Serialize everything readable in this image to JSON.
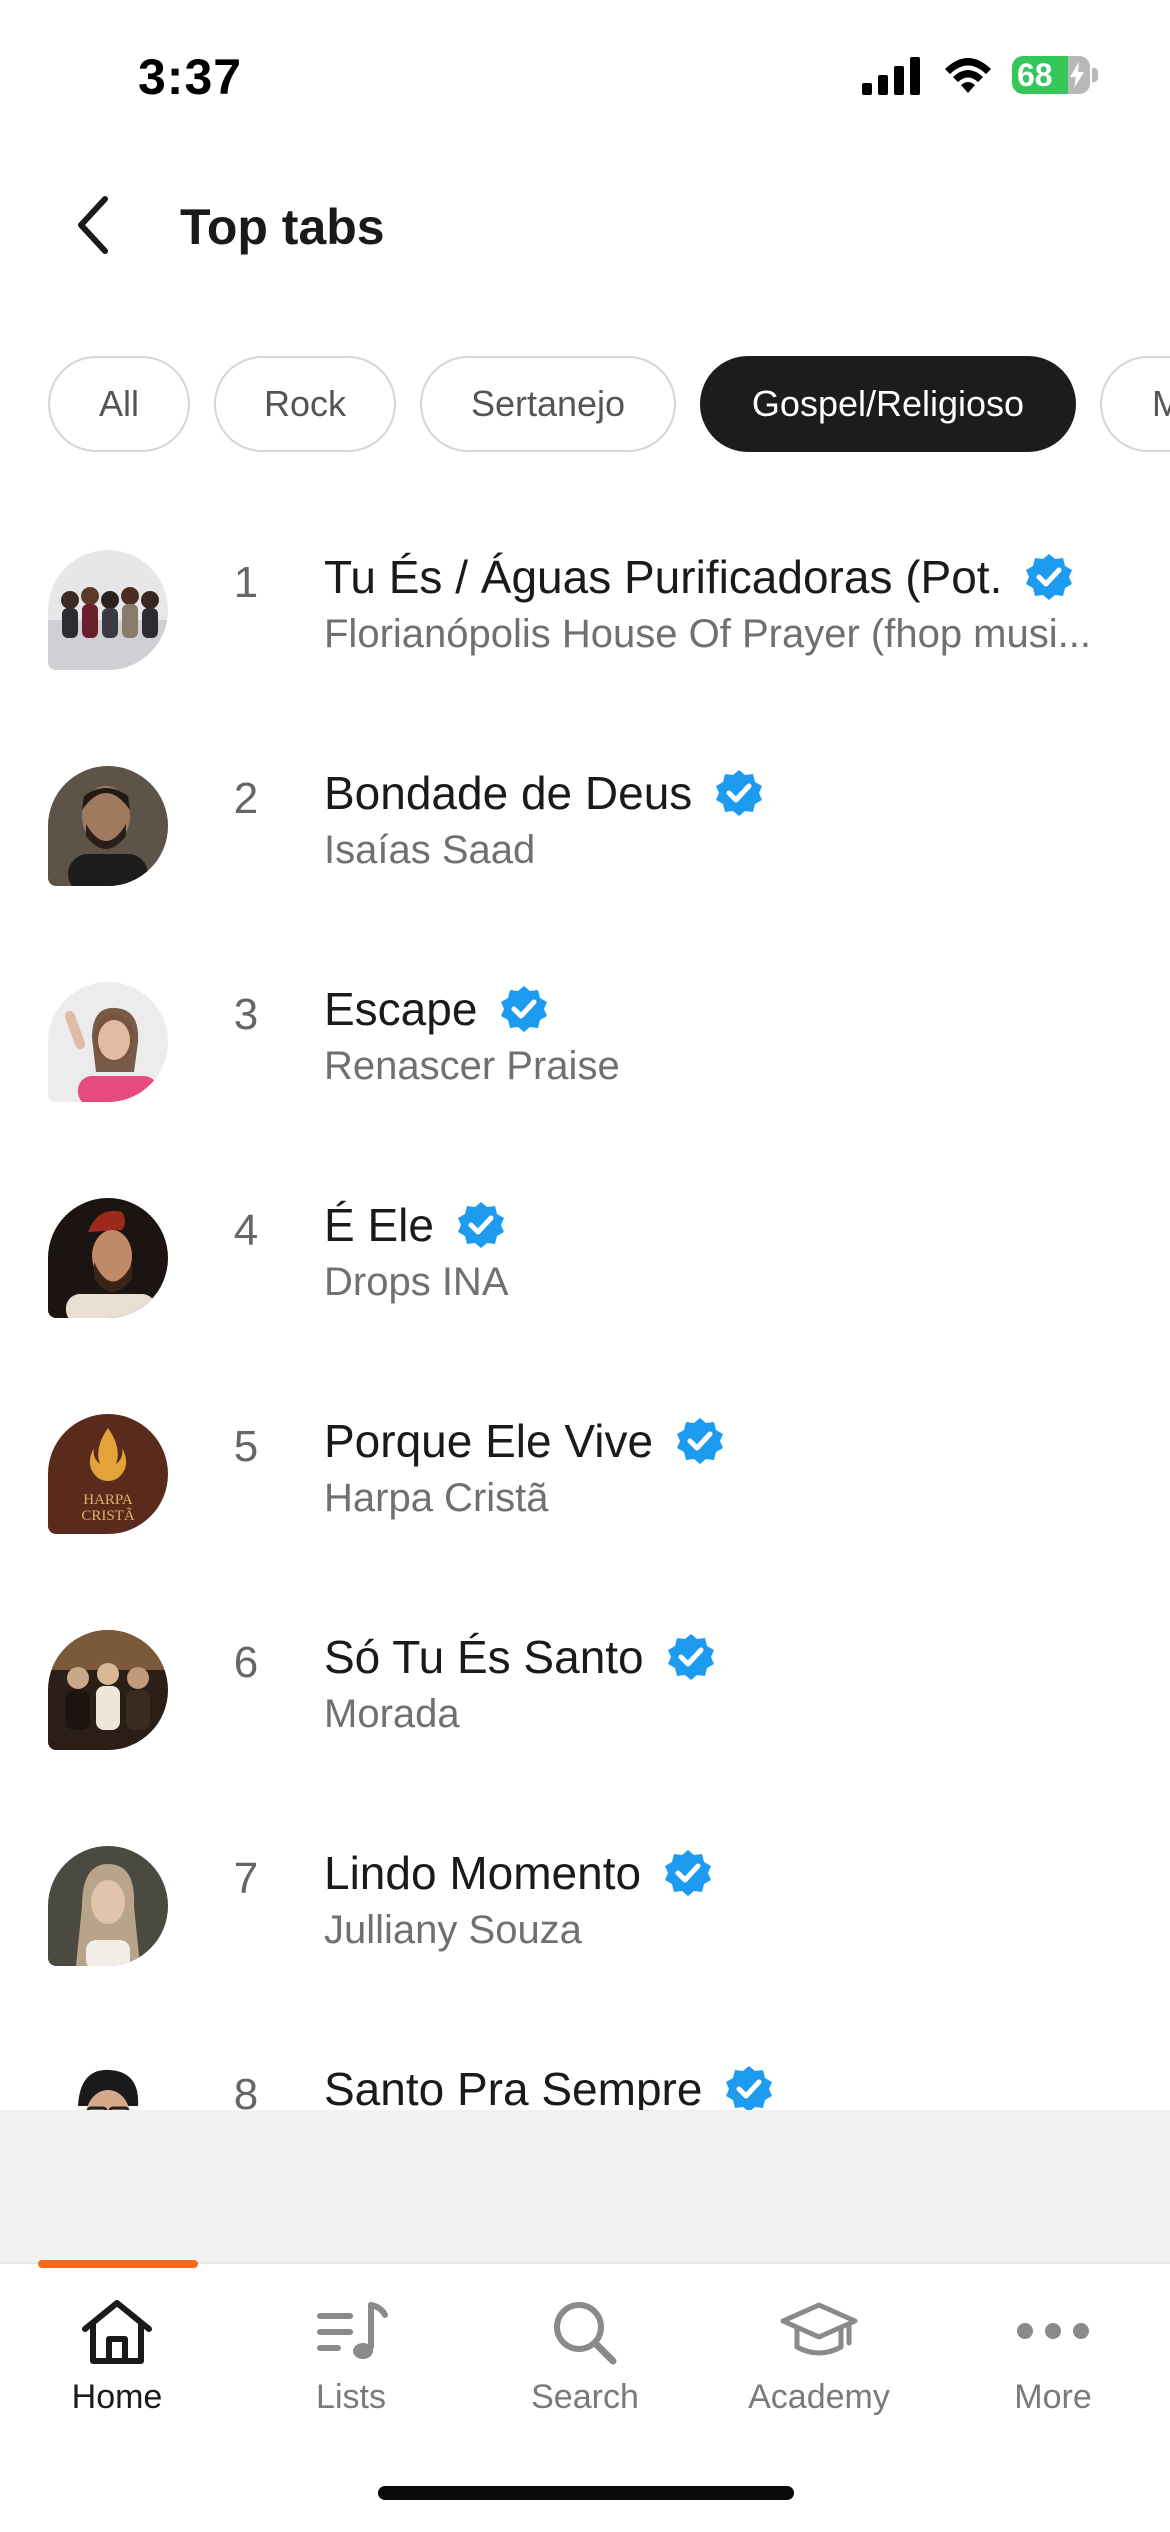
{
  "status_bar": {
    "time": "3:37",
    "battery": "68"
  },
  "header": {
    "title": "Top tabs"
  },
  "chips": [
    {
      "label": "All",
      "active": false
    },
    {
      "label": "Rock",
      "active": false
    },
    {
      "label": "Sertanejo",
      "active": false
    },
    {
      "label": "Gospel/Religioso",
      "active": true
    },
    {
      "label": "M",
      "active": false
    }
  ],
  "list": [
    {
      "rank": "1",
      "title": "Tu És / Águas Purificadoras (Pot.",
      "artist": "Florianópolis House Of Prayer (fhop musi...",
      "verified": true
    },
    {
      "rank": "2",
      "title": "Bondade de Deus",
      "artist": "Isaías Saad",
      "verified": true
    },
    {
      "rank": "3",
      "title": "Escape",
      "artist": "Renascer Praise",
      "verified": true
    },
    {
      "rank": "4",
      "title": "É Ele",
      "artist": "Drops INA",
      "verified": true
    },
    {
      "rank": "5",
      "title": "Porque Ele Vive",
      "artist": "Harpa Cristã",
      "verified": true
    },
    {
      "rank": "6",
      "title": "Só Tu És Santo",
      "artist": "Morada",
      "verified": true
    },
    {
      "rank": "7",
      "title": "Lindo Momento",
      "artist": "Julliany Souza",
      "verified": true
    },
    {
      "rank": "8",
      "title": "Santo Pra Sempre",
      "artist": "",
      "verified": true
    }
  ],
  "thumb_logo_text": "HARPA CRISTÃ",
  "nav": [
    {
      "label": "Home",
      "icon": "home-icon",
      "active": true
    },
    {
      "label": "Lists",
      "icon": "lists-icon",
      "active": false
    },
    {
      "label": "Search",
      "icon": "search-icon",
      "active": false
    },
    {
      "label": "Academy",
      "icon": "academy-icon",
      "active": false
    },
    {
      "label": "More",
      "icon": "more-icon",
      "active": false
    }
  ],
  "colors": {
    "accent": "#f56a1c",
    "verified": "#1d9bf0",
    "chip_active": "#1c1c1c"
  }
}
